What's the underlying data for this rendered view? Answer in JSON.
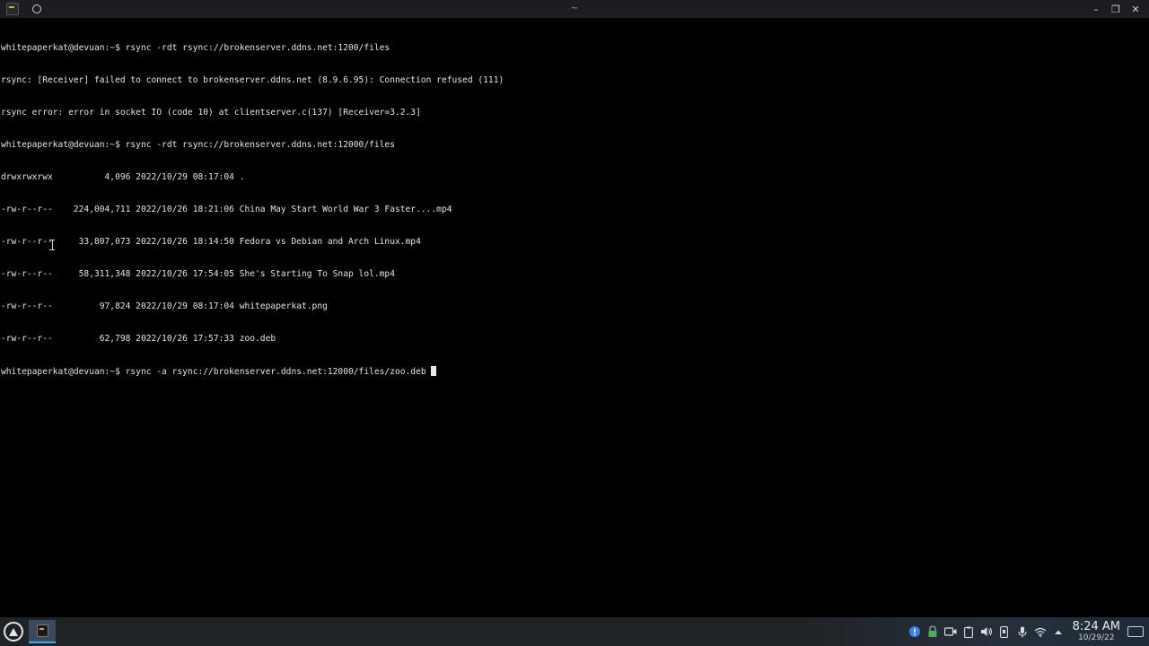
{
  "window": {
    "title": "~",
    "controls": {
      "minimize": "–",
      "maximize": "❐",
      "close": "✕"
    }
  },
  "terminal": {
    "lines": [
      "whitepaperkat@devuan:~$ rsync -rdt rsync://brokenserver.ddns.net:1200/files",
      "rsync: [Receiver] failed to connect to brokenserver.ddns.net (8.9.6.95): Connection refused (111)",
      "rsync error: error in socket IO (code 10) at clientserver.c(137) [Receiver=3.2.3]",
      "whitepaperkat@devuan:~$ rsync -rdt rsync://brokenserver.ddns.net:12000/files",
      "drwxrwxrwx          4,096 2022/10/29 08:17:04 .",
      "-rw-r--r--    224,004,711 2022/10/26 18:21:06 China May Start World War 3 Faster....mp4",
      "-rw-r--r--     33,807,073 2022/10/26 18:14:50 Fedora vs Debian and Arch Linux.mp4",
      "-rw-r--r--     58,311,348 2022/10/26 17:54:05 She's Starting To Snap lol.mp4",
      "-rw-r--r--         97,824 2022/10/29 08:17:04 whitepaperkat.png",
      "-rw-r--r--         62,798 2022/10/26 17:57:33 zoo.deb"
    ],
    "prompt_line": "whitepaperkat@devuan:~$ rsync -a rsync://brokenserver.ddns.net:12000/files/zoo.deb "
  },
  "taskbar": {
    "clock_time": "8:24 AM",
    "clock_date": "10/29/22"
  },
  "colors": {
    "terminal_bg": "#000000",
    "terminal_fg": "#e4e4e4",
    "taskbar_bg": "#202326",
    "accent": "#3daee9"
  }
}
